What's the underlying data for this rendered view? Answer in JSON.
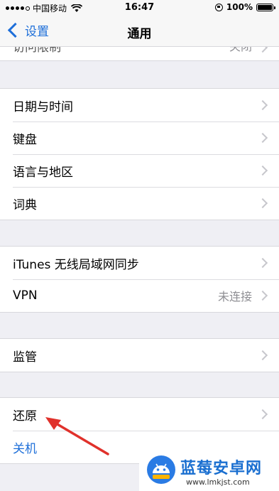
{
  "status_bar": {
    "carrier": "中国移动",
    "time": "16:47",
    "battery": "100%",
    "signal_bars_filled": 4,
    "signal_bars_total": 5,
    "battery_level": 1.0
  },
  "nav": {
    "back_label": "设置",
    "title": "通用"
  },
  "partial_row": {
    "label": "访问限制",
    "value": "关闭"
  },
  "groups": [
    {
      "rows": [
        {
          "label": "日期与时间"
        },
        {
          "label": "键盘"
        },
        {
          "label": "语言与地区"
        },
        {
          "label": "词典"
        }
      ]
    },
    {
      "rows": [
        {
          "label": "iTunes 无线局域网同步"
        },
        {
          "label": "VPN",
          "value": "未连接"
        }
      ]
    },
    {
      "rows": [
        {
          "label": "监管"
        }
      ]
    },
    {
      "rows": [
        {
          "label": "还原"
        },
        {
          "label": "关机"
        }
      ]
    }
  ],
  "watermark": {
    "title": "蓝莓安卓网",
    "url": "www.lmkjst.com"
  },
  "colors": {
    "accent": "#1e6fd9",
    "background": "#efeff4",
    "annotation_arrow": "#e0312b"
  }
}
